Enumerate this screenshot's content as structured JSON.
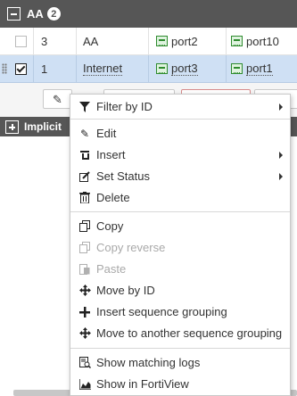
{
  "group": {
    "title": "AA",
    "count": "2"
  },
  "rows": [
    {
      "num": "3",
      "name": "AA",
      "src": "port2",
      "dst": "port10",
      "checked": false
    },
    {
      "num": "1",
      "name": "Internet",
      "src": "port3",
      "dst": "port1",
      "checked": true
    }
  ],
  "implicit": {
    "label": "Implicit"
  },
  "menu": {
    "filter_by_id": "Filter by ID",
    "edit": "Edit",
    "insert": "Insert",
    "set_status": "Set Status",
    "delete": "Delete",
    "copy": "Copy",
    "copy_reverse": "Copy reverse",
    "paste": "Paste",
    "move_by_id": "Move by ID",
    "insert_sequence_grouping": "Insert sequence grouping",
    "move_to_another_sequence_grouping": "Move to another sequence grouping",
    "show_matching_logs": "Show matching logs",
    "show_in_fortiview": "Show in FortiView"
  },
  "colors": {
    "header_bg": "#565656",
    "selected_row": "#cfe0f4",
    "port_green": "#2e8b2e"
  }
}
